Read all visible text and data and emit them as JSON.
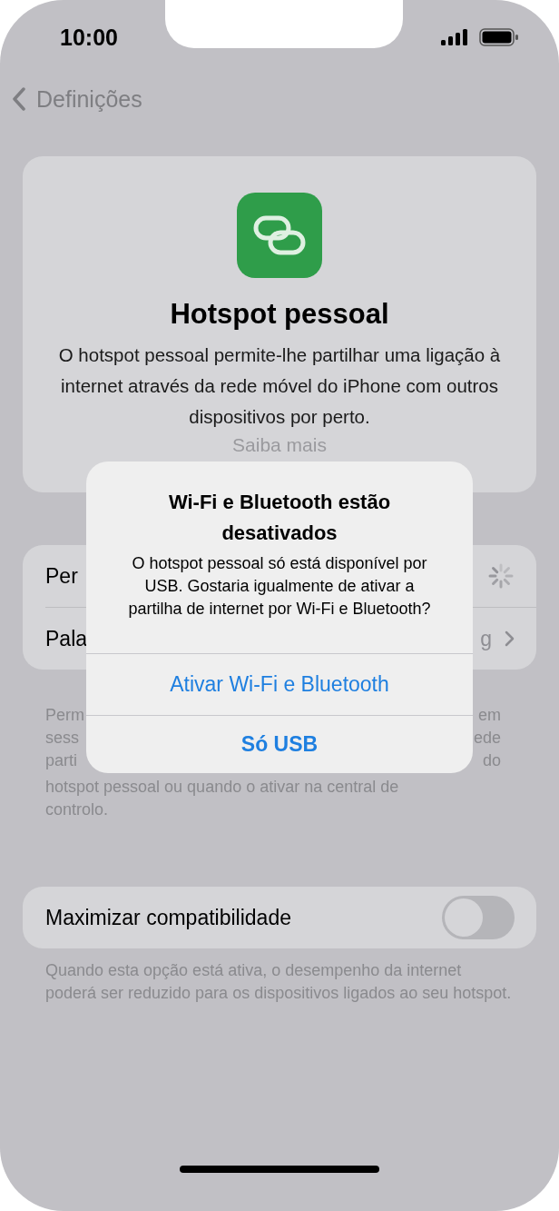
{
  "status_bar": {
    "time": "10:00"
  },
  "nav": {
    "back": "Definições"
  },
  "header": {
    "title": "Hotspot pessoal",
    "description": "O hotspot pessoal permite-lhe partilhar uma ligação à internet através da rede móvel do iPhone com outros dispositivos por perto.",
    "link": "Saiba mais"
  },
  "rows": [
    {
      "kind": "spinner",
      "label": "Per"
    },
    {
      "kind": "chevron",
      "label": "Pala",
      "value": "g"
    }
  ],
  "footer_lines": [
    {
      "left": "Perm",
      "right": "em"
    },
    {
      "left": "sess",
      "right": "ede"
    },
    {
      "left": "parti",
      "right": "do"
    },
    {
      "left": "hotspot pessoal ou quando o ativar na central de"
    },
    {
      "left": "controlo."
    }
  ],
  "compat": {
    "label": "Maximizar compatibilidade",
    "on": false,
    "note": "Quando esta opção está ativa, o desempenho da internet poderá ser reduzido para os dispositivos ligados ao seu hotspot."
  },
  "alert": {
    "title": "Wi-Fi e Bluetooth estão desativados",
    "message": "O hotspot pessoal só está disponível por USB. Gostaria igualmente de ativar a partilha de internet por Wi-Fi e Bluetooth?",
    "actions": [
      {
        "label": "Ativar Wi-Fi e Bluetooth",
        "bold": false
      },
      {
        "label": "Só USB",
        "bold": true
      }
    ]
  }
}
